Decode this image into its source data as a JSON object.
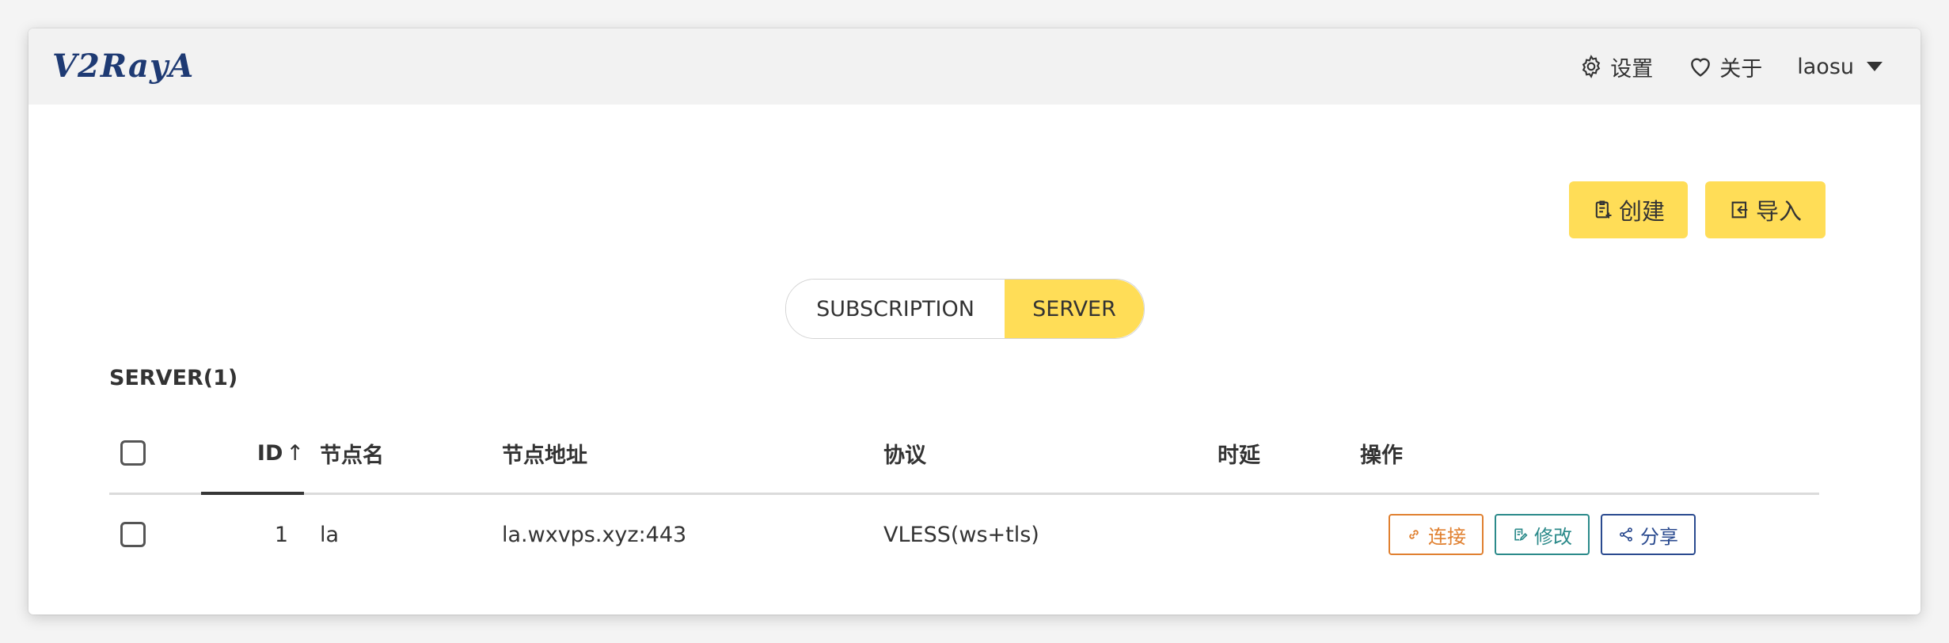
{
  "app": {
    "logo_text": "V2RayA"
  },
  "nav": {
    "settings_label": "设置",
    "about_label": "关于",
    "user_label": "laosu"
  },
  "actions": {
    "create_label": "创建",
    "import_label": "导入"
  },
  "tabs": [
    {
      "label": "SUBSCRIPTION",
      "active": false
    },
    {
      "label": "SERVER",
      "active": true
    }
  ],
  "section": {
    "title": "SERVER(1)"
  },
  "table": {
    "headers": {
      "id": "ID",
      "sort": "↑",
      "name": "节点名",
      "address": "节点地址",
      "protocol": "协议",
      "latency": "时延",
      "ops": "操作"
    },
    "rows": [
      {
        "id": "1",
        "name": "la",
        "address": "la.wxvps.xyz:443",
        "protocol": "VLESS(ws+tls)",
        "latency": ""
      }
    ],
    "row_actions": {
      "connect": "连接",
      "edit": "修改",
      "share": "分享"
    }
  },
  "colors": {
    "accent_yellow": "#ffdd57",
    "connect": "#e08030",
    "edit": "#2b8a8a",
    "share": "#2a4a8f",
    "logo": "#1e3a73"
  }
}
